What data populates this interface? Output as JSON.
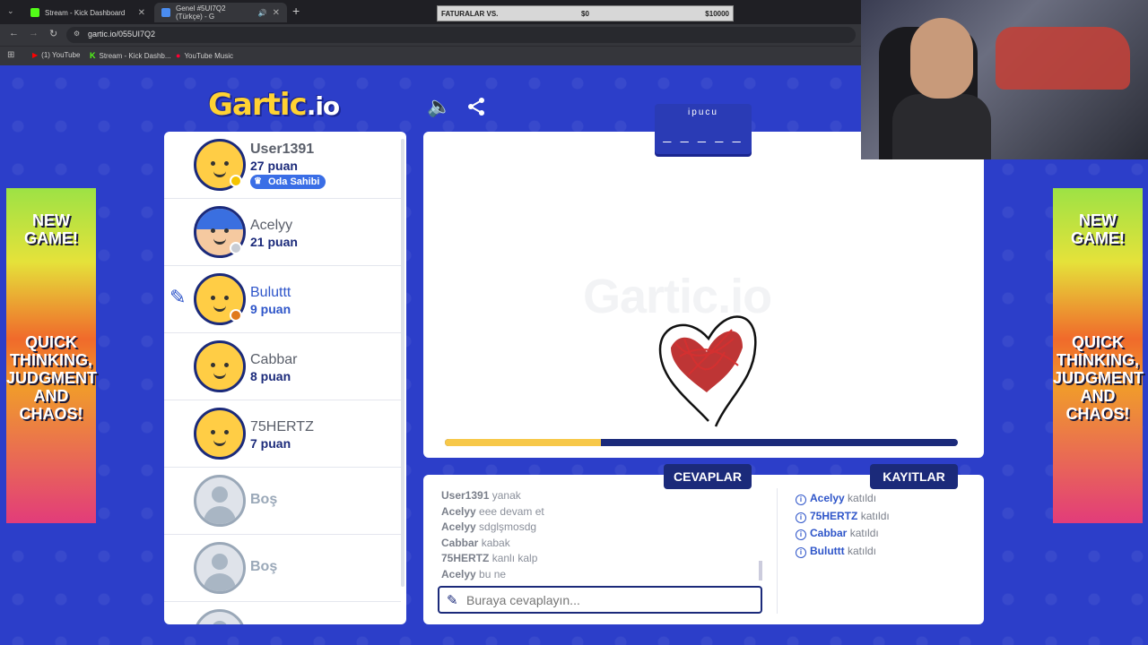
{
  "browser": {
    "tabs": [
      {
        "title": "Stream - Kick Dashboard",
        "fav_color": "#53fc18"
      },
      {
        "title": "Genel #5UI7Q2 (Türkçe) - G",
        "fav_color": "#4a8cf0"
      }
    ],
    "url": "gartic.io/055UI7Q2",
    "bookmarks": [
      "(1) YouTube",
      "Stream - Kick Dashb...",
      "YouTube Music"
    ]
  },
  "overlay": {
    "label": "FATURALAR VS.",
    "current": "$0",
    "goal": "$10000"
  },
  "game": {
    "logo_main": "Gartic",
    "logo_suffix": ".io",
    "hint": {
      "label": "ipucu",
      "blanks": "_ _ _ _ _"
    },
    "watermark": "Gartic.io",
    "progress_fraction": 0.305,
    "players": [
      {
        "name": "User1391",
        "score": "27 puan",
        "owner_badge": "Oda Sahibi",
        "status_color": "#f5c400",
        "avatar": "yellow"
      },
      {
        "name": "Acelyy",
        "score": "21 puan",
        "status_color": "#c8ccd4",
        "avatar": "blue-hair"
      },
      {
        "name": "Buluttt",
        "score": "9 puan",
        "status_color": "#e07a1c",
        "avatar": "yellow",
        "drawing": true
      },
      {
        "name": "Cabbar",
        "score": "8 puan",
        "avatar": "yellow"
      },
      {
        "name": "75HERTZ",
        "score": "7 puan",
        "avatar": "yellow"
      },
      {
        "name": "Boş",
        "score": "",
        "avatar": "empty"
      },
      {
        "name": "Boş",
        "score": "",
        "avatar": "empty"
      }
    ],
    "answers_title": "CEVAPLAR",
    "logs_title": "KAYITLAR",
    "answers": [
      {
        "user": "User1391",
        "text": "yanak"
      },
      {
        "user": "Acelyy",
        "text": "eee devam et"
      },
      {
        "user": "Acelyy",
        "text": "sdglşmosdg"
      },
      {
        "user": "Cabbar",
        "text": "kabak"
      },
      {
        "user": "75HERTZ",
        "text": "kanlı kalp"
      },
      {
        "user": "Acelyy",
        "text": "bu ne"
      }
    ],
    "logs": [
      {
        "user": "Acelyy",
        "text": "katıldı"
      },
      {
        "user": "75HERTZ",
        "text": "katıldı"
      },
      {
        "user": "Cabbar",
        "text": "katıldı"
      },
      {
        "user": "Buluttt",
        "text": "katıldı"
      }
    ],
    "answer_placeholder": "Buraya cevaplayın...",
    "ad": {
      "line1": "NEW GAME!",
      "line2": "QUICK THINKING, JUDGMENT AND CHAOS!"
    }
  }
}
